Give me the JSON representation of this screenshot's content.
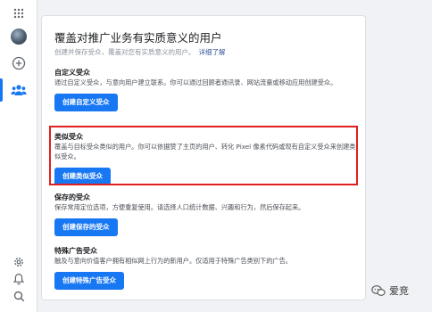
{
  "sidebar": {
    "icons": [
      "grid-icon",
      "avatar",
      "plus-circle-icon",
      "audience-icon",
      "gear-icon",
      "bell-icon",
      "search-icon"
    ]
  },
  "page": {
    "title": "覆盖对推广业务有实质意义的用户",
    "subtitle": "创建并保存受众，覆盖对您有实质意义的用户。",
    "learn_more": "详细了解"
  },
  "sections": [
    {
      "title": "自定义受众",
      "desc": "通过自定义受众，与意向用户建立联系。你可以通过回顾者通讯录、网站流量或移动应用创建受众。",
      "button": "创建自定义受众"
    },
    {
      "title": "类似受众",
      "desc": "覆盖与目标受众类似的用户。你可以依据赞了主页的用户、转化 Pixel 像素代码或现有自定义受众来创建类似受众。",
      "button": "创建类似受众"
    },
    {
      "title": "保存的受众",
      "desc": "保存常用定位选项，方便重复使用。请选择人口统计数据、兴趣和行为，然后保存起来。",
      "button": "创建保存的受众"
    },
    {
      "title": "特殊广告受众",
      "desc": "触及与意向价值客户拥有相似网上行为的新用户。仅适用于特殊广告类别下的广告。",
      "button": "创建特殊广告受众"
    }
  ],
  "watermark": {
    "text": "爱竞"
  },
  "colors": {
    "accent": "#1877f2",
    "highlight": "#e02020"
  }
}
